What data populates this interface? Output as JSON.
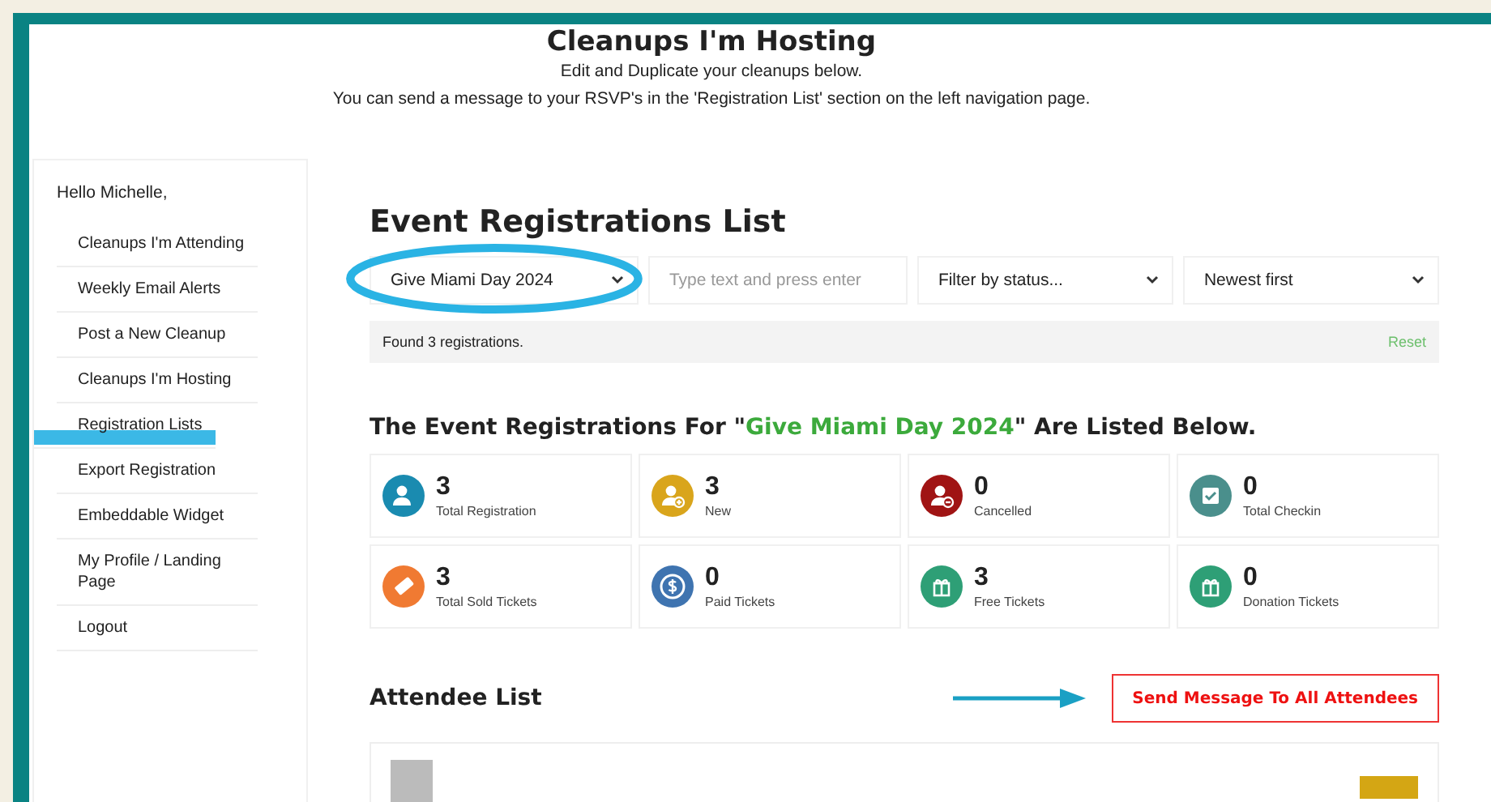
{
  "page": {
    "title": "Cleanups I'm Hosting",
    "subtitle_lines": [
      "Edit and Duplicate your cleanups below.",
      "You can send a message to your RSVP's in the 'Registration List' section on the left navigation page."
    ]
  },
  "sidebar": {
    "greeting": "Hello Michelle,",
    "items": [
      {
        "label": "Cleanups I'm Attending",
        "selected": false
      },
      {
        "label": "Weekly Email Alerts",
        "selected": false
      },
      {
        "label": "Post a New Cleanup",
        "selected": false
      },
      {
        "label": "Cleanups I'm Hosting",
        "selected": false
      },
      {
        "label": "Registration Lists",
        "selected": true
      },
      {
        "label": "Export Registration",
        "selected": false
      },
      {
        "label": "Embeddable Widget",
        "selected": false
      },
      {
        "label": "My Profile / Landing Page",
        "selected": false
      },
      {
        "label": "Logout",
        "selected": false
      }
    ]
  },
  "main": {
    "heading": "Event Registrations List",
    "filters": [
      {
        "kind": "select",
        "value": "Give Miami Day 2024",
        "circled": true
      },
      {
        "kind": "input",
        "placeholder": "Type text and press enter"
      },
      {
        "kind": "select",
        "value": "Filter by status..."
      },
      {
        "kind": "select",
        "value": "Newest first"
      }
    ],
    "result_bar": {
      "text": "Found 3 registrations.",
      "reset": "Reset"
    },
    "summary": {
      "before": "The Event Registrations For \"",
      "event": "Give Miami Day 2024",
      "after": "\" Are Listed Below."
    },
    "stats": [
      {
        "value": "3",
        "label": "Total Registration",
        "kind": "person",
        "color": "#1a8bb0"
      },
      {
        "value": "3",
        "label": "New",
        "kind": "person-plus",
        "color": "#d9a51c"
      },
      {
        "value": "0",
        "label": "Cancelled",
        "kind": "person-minus",
        "color": "#a01414"
      },
      {
        "value": "0",
        "label": "Total Checkin",
        "kind": "check",
        "color": "#4a8f8c"
      },
      {
        "value": "3",
        "label": "Total Sold Tickets",
        "kind": "ticket",
        "color": "#f07a32"
      },
      {
        "value": "0",
        "label": "Paid Tickets",
        "kind": "dollar",
        "color": "#3f74b0"
      },
      {
        "value": "3",
        "label": "Free Tickets",
        "kind": "gift",
        "color": "#2e9f76"
      },
      {
        "value": "0",
        "label": "Donation Tickets",
        "kind": "gift",
        "color": "#2e9f76"
      }
    ],
    "attendees": {
      "heading": "Attendee List",
      "send_button": "Send Message To All Attendees",
      "pointer_arrow": true
    }
  }
}
